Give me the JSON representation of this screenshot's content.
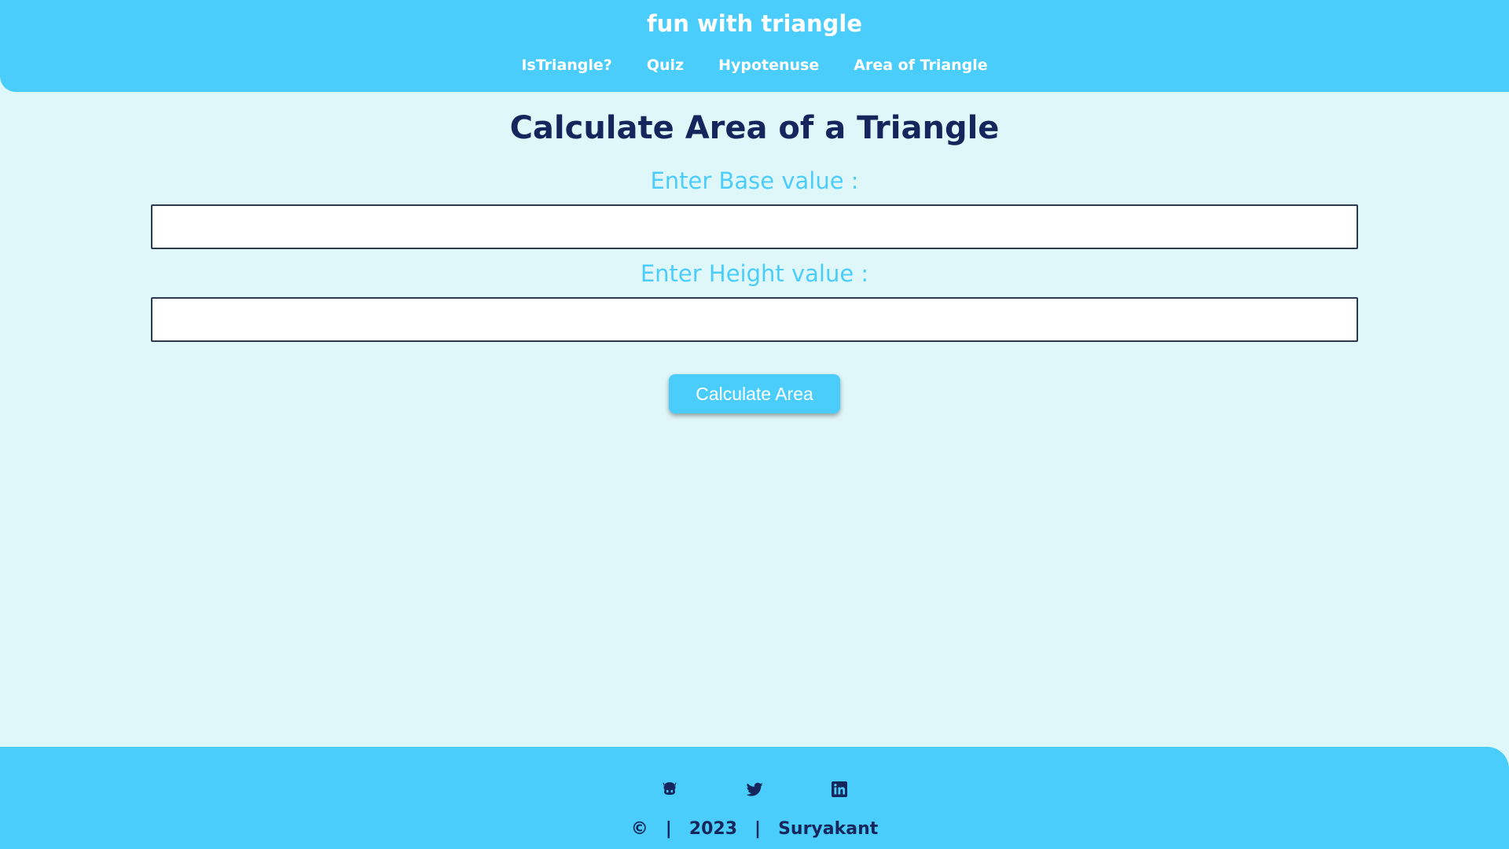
{
  "header": {
    "title": "fun with triangle",
    "nav": [
      {
        "label": "IsTriangle?"
      },
      {
        "label": "Quiz"
      },
      {
        "label": "Hypotenuse"
      },
      {
        "label": "Area of Triangle"
      }
    ]
  },
  "main": {
    "heading": "Calculate Area of a Triangle",
    "base_label": "Enter Base value :",
    "base_value": "",
    "height_label": "Enter Height value :",
    "height_value": "",
    "button_label": "Calculate Area"
  },
  "footer": {
    "social_icons": [
      "github-icon",
      "twitter-icon",
      "linkedin-icon"
    ],
    "copyright_symbol": "©",
    "separator": "|",
    "year": "2023",
    "author": "Suryakant"
  },
  "colors": {
    "accent": "#4bcdfb",
    "background": "#dff7f9",
    "dark_text": "#14265c"
  }
}
